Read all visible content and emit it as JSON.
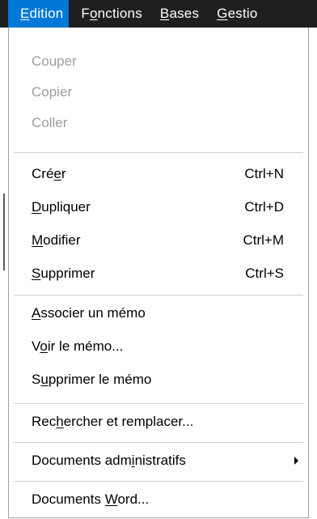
{
  "menubar": {
    "items": [
      {
        "pre": "",
        "mn": "E",
        "post": "dition"
      },
      {
        "pre": "F",
        "mn": "o",
        "post": "nctions"
      },
      {
        "pre": "",
        "mn": "B",
        "post": "ases"
      },
      {
        "pre": "",
        "mn": "G",
        "post": "estio"
      }
    ]
  },
  "menu": {
    "couper": {
      "label": "Couper"
    },
    "copier": {
      "label": "Copier"
    },
    "coller": {
      "label": "Coller"
    },
    "creer": {
      "pre": "Cré",
      "mn": "e",
      "post": "r",
      "shortcut": "Ctrl+N"
    },
    "dupliquer": {
      "pre": "",
      "mn": "D",
      "post": "upliquer",
      "shortcut": "Ctrl+D"
    },
    "modifier": {
      "pre": "",
      "mn": "M",
      "post": "odifier",
      "shortcut": "Ctrl+M"
    },
    "supprimer": {
      "pre": "",
      "mn": "S",
      "post": "upprimer",
      "shortcut": "Ctrl+S"
    },
    "associer_memo": {
      "pre": "",
      "mn": "A",
      "post": "ssocier un mémo"
    },
    "voir_memo": {
      "pre": "V",
      "mn": "o",
      "post": "ir le mémo..."
    },
    "supprimer_memo": {
      "pre": "S",
      "mn": "u",
      "post": "pprimer le mémo"
    },
    "rechercher": {
      "pre": "Rec",
      "mn": "h",
      "post": "ercher et remplacer..."
    },
    "documents_admin": {
      "pre": "Documents adm",
      "mn": "i",
      "post": "nistratifs"
    },
    "documents_word": {
      "pre": "Documents ",
      "mn": "W",
      "post": "ord..."
    }
  }
}
